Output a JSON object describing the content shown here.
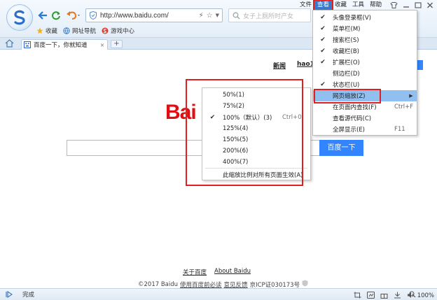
{
  "browser": {
    "address": "http://www.baidu.com/",
    "search_placeholder": "女子上厕所时产女",
    "menu": [
      "文件",
      "查看",
      "收藏",
      "工具",
      "帮助"
    ],
    "bookmarks": [
      "收藏",
      "网址导航",
      "游戏中心"
    ]
  },
  "tab": {
    "title": "百度一下，你就知道",
    "close": "×",
    "new": "+"
  },
  "page": {
    "top_links": [
      "新闻",
      "hao12"
    ],
    "logo_text": "Bai",
    "search_button": "百度一下",
    "footer_links": [
      "关于百度",
      "About Baidu"
    ],
    "copyright_prefix": "©2017 Baidu",
    "copyright_links": [
      "使用百度前必读",
      "意见反馈"
    ],
    "icp": "京ICP证030173号"
  },
  "view_menu": {
    "items": [
      {
        "label": "头像登录框(V)",
        "checked": true,
        "shortcut": ""
      },
      {
        "label": "菜单栏(M)",
        "checked": true,
        "shortcut": ""
      },
      {
        "label": "搜索栏(S)",
        "checked": true,
        "shortcut": ""
      },
      {
        "label": "收藏栏(B)",
        "checked": true,
        "shortcut": ""
      },
      {
        "label": "扩展栏(O)",
        "checked": true,
        "shortcut": ""
      },
      {
        "label": "侧边栏(D)",
        "checked": false,
        "shortcut": ""
      },
      {
        "label": "状态栏(U)",
        "checked": true,
        "shortcut": ""
      },
      {
        "label": "网页缩放(Z)",
        "checked": false,
        "shortcut": "",
        "submenu": true,
        "highlighted": true
      },
      {
        "label": "在页面内查找(F)",
        "checked": false,
        "shortcut": "Ctrl+F"
      },
      {
        "label": "查看源代码(C)",
        "checked": false,
        "shortcut": ""
      },
      {
        "label": "全屏显示(E)",
        "checked": false,
        "shortcut": "F11"
      }
    ]
  },
  "zoom_menu": {
    "items": [
      {
        "label": "50%(1)",
        "checked": false,
        "shortcut": ""
      },
      {
        "label": "75%(2)",
        "checked": false,
        "shortcut": ""
      },
      {
        "label": "100%（默认）(3)",
        "checked": true,
        "shortcut": "Ctrl+0"
      },
      {
        "label": "125%(4)",
        "checked": false,
        "shortcut": ""
      },
      {
        "label": "150%(5)",
        "checked": false,
        "shortcut": ""
      },
      {
        "label": "200%(6)",
        "checked": false,
        "shortcut": ""
      },
      {
        "label": "400%(7)",
        "checked": false,
        "shortcut": ""
      }
    ],
    "apply_all": "此缩放比例对所有页面生效(A)"
  },
  "status": {
    "text": "完成",
    "zoom": "100%"
  },
  "colors": {
    "accent": "#3385ff",
    "annotation": "#e02020",
    "highlight": "#90bff0",
    "baidu_red": "#de0f14"
  }
}
